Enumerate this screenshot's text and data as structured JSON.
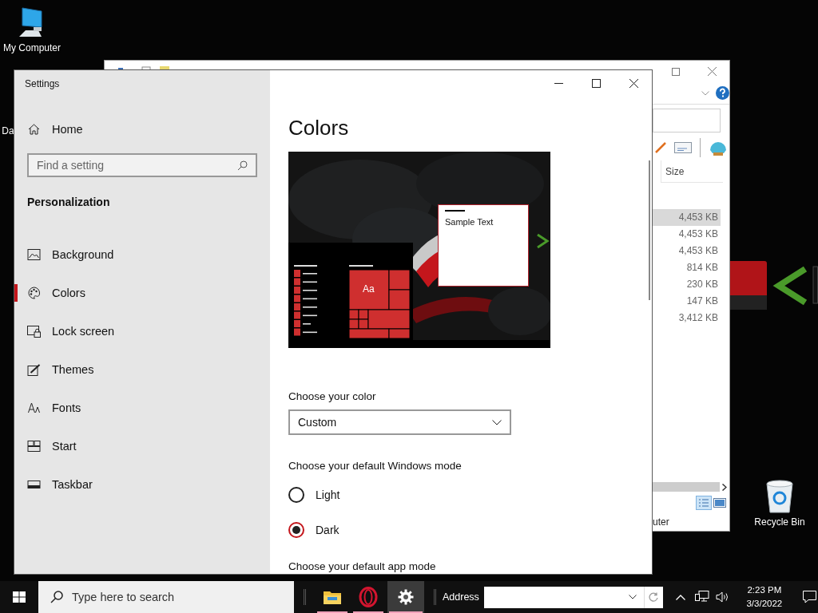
{
  "desktop": {
    "icons": [
      {
        "label": "My Computer"
      },
      {
        "label": "Da"
      },
      {
        "label": "Recycle Bin"
      }
    ]
  },
  "explorer_window": {
    "column_header": "Size",
    "sizes": [
      {
        "text": "4,453 KB",
        "selected": true
      },
      {
        "text": "4,453 KB",
        "selected": false
      },
      {
        "text": "4,453 KB",
        "selected": false
      },
      {
        "text": "814 KB",
        "selected": false
      },
      {
        "text": "230 KB",
        "selected": false
      },
      {
        "text": "147 KB",
        "selected": false
      },
      {
        "text": "3,412 KB",
        "selected": false
      }
    ],
    "status_text": "uter"
  },
  "settings_window": {
    "title": "Settings",
    "sidebar": {
      "home": "Home",
      "search": {
        "placeholder": "Find a setting"
      },
      "section": "Personalization",
      "items": [
        {
          "label": "Background",
          "selected": false
        },
        {
          "label": "Colors",
          "selected": true
        },
        {
          "label": "Lock screen",
          "selected": false
        },
        {
          "label": "Themes",
          "selected": false
        },
        {
          "label": "Fonts",
          "selected": false
        },
        {
          "label": "Start",
          "selected": false
        },
        {
          "label": "Taskbar",
          "selected": false
        }
      ]
    },
    "page": {
      "heading": "Colors",
      "preview": {
        "sample_text": "Sample Text",
        "tile_text": "Aa"
      },
      "color_label": "Choose your color",
      "color_dropdown": {
        "value": "Custom"
      },
      "windows_mode": {
        "label": "Choose your default Windows mode",
        "options": [
          {
            "label": "Light",
            "selected": false
          },
          {
            "label": "Dark",
            "selected": true
          }
        ]
      },
      "app_mode_label": "Choose your default app mode"
    }
  },
  "taskbar": {
    "search": {
      "placeholder": "Type here to search"
    },
    "apps": [
      {
        "running": true,
        "selected": false
      },
      {
        "running": true,
        "selected": false
      },
      {
        "running": true,
        "selected": true
      }
    ],
    "address": {
      "label": "Address"
    },
    "clock": {
      "time": "2:23 PM",
      "date": "3/3/2022"
    }
  }
}
